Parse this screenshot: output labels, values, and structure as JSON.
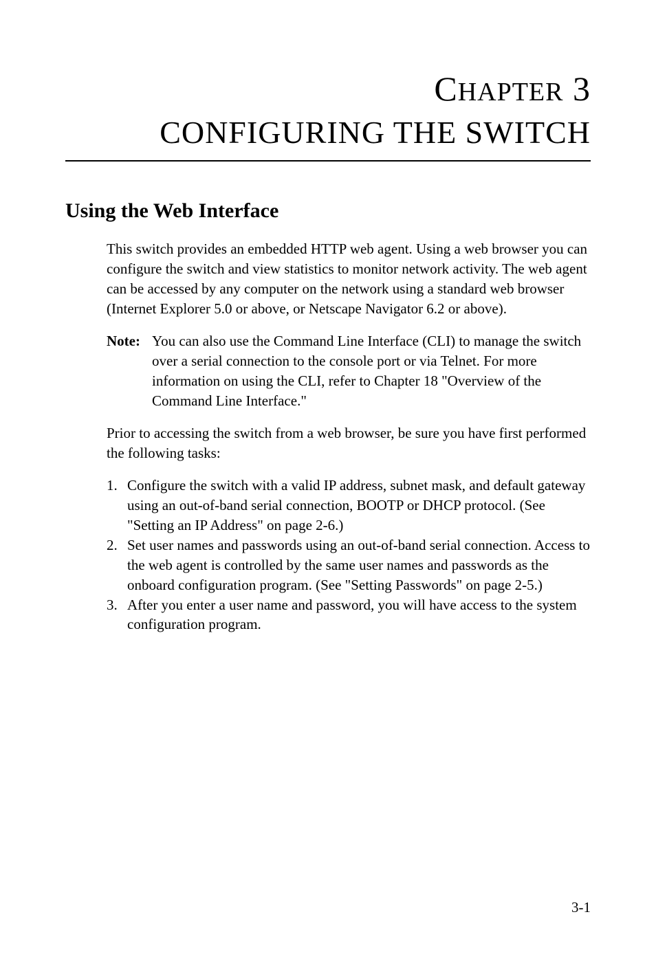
{
  "chapter": {
    "label_prefix": "C",
    "label_rest": "HAPTER",
    "number": "3",
    "title": "CONFIGURING THE SWITCH"
  },
  "section": {
    "heading": "Using the Web Interface"
  },
  "body": {
    "intro": "This switch provides an embedded HTTP web agent. Using a web browser you can configure the switch and view statistics to monitor network activity. The web agent can be accessed by any computer on the network using a standard web browser (Internet Explorer 5.0 or above, or Netscape Navigator 6.2 or above).",
    "note_label": "Note:",
    "note_body": "You can also use the Command Line Interface (CLI) to manage the switch over a serial connection to the console port or via Telnet. For more information on using the CLI, refer to Chapter 18 \"Overview of the Command Line Interface.\"",
    "pretask": "Prior to accessing the switch from a web browser, be sure you have first performed the following tasks:",
    "list": [
      {
        "num": "1.",
        "text": "Configure the switch with a valid IP address, subnet mask, and default gateway using an out-of-band serial connection, BOOTP or DHCP protocol. (See \"Setting an IP Address\" on page 2-6.)"
      },
      {
        "num": "2.",
        "text": "Set user names and passwords using an out-of-band serial connection. Access to the web agent is controlled by the same user names and passwords as the onboard configuration program. (See \"Setting Passwords\" on page 2-5.)"
      },
      {
        "num": "3.",
        "text": "After you enter a user name and password, you will have access to the system configuration program."
      }
    ]
  },
  "page_number": "3-1"
}
